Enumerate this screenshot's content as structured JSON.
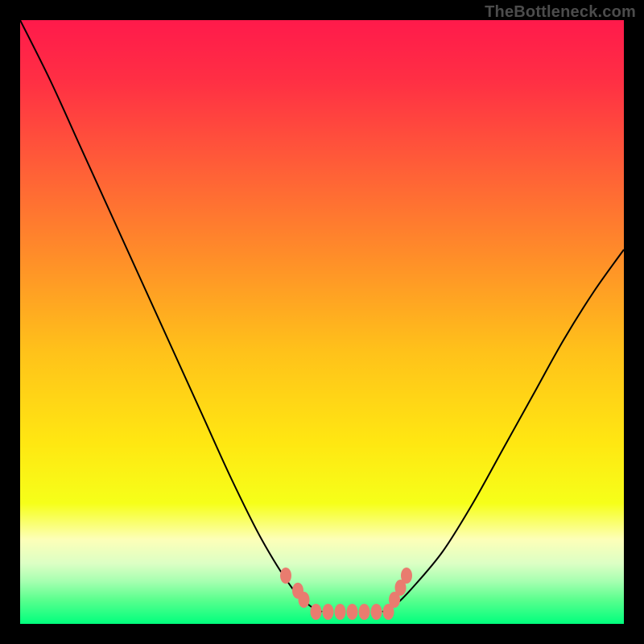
{
  "watermark": "TheBottleneck.com",
  "chart_data": {
    "type": "line",
    "title": "",
    "xlabel": "",
    "ylabel": "",
    "xlim": [
      0,
      100
    ],
    "ylim": [
      0,
      100
    ],
    "background_gradient_stops": [
      {
        "offset": 0.0,
        "color": "#ff1a4b"
      },
      {
        "offset": 0.1,
        "color": "#ff2f44"
      },
      {
        "offset": 0.25,
        "color": "#ff6037"
      },
      {
        "offset": 0.4,
        "color": "#ff9028"
      },
      {
        "offset": 0.55,
        "color": "#ffc21a"
      },
      {
        "offset": 0.7,
        "color": "#ffe712"
      },
      {
        "offset": 0.8,
        "color": "#f6ff19"
      },
      {
        "offset": 0.86,
        "color": "#fdffb8"
      },
      {
        "offset": 0.9,
        "color": "#dcffc4"
      },
      {
        "offset": 0.93,
        "color": "#a5ffb0"
      },
      {
        "offset": 0.96,
        "color": "#5aff8e"
      },
      {
        "offset": 1.0,
        "color": "#00ff7d"
      }
    ],
    "series": [
      {
        "name": "curve-left",
        "color": "#000000",
        "width": 2,
        "x": [
          0,
          5,
          10,
          15,
          20,
          25,
          30,
          35,
          40,
          45,
          48,
          50
        ],
        "y": [
          100,
          90,
          79,
          68,
          57,
          46,
          35,
          24,
          14,
          6,
          3,
          2
        ]
      },
      {
        "name": "curve-right",
        "color": "#000000",
        "width": 2,
        "x": [
          60,
          62,
          65,
          70,
          75,
          80,
          85,
          90,
          95,
          100
        ],
        "y": [
          2,
          3,
          6,
          12,
          20,
          29,
          38,
          47,
          55,
          62
        ]
      },
      {
        "name": "markers-left",
        "color": "#e97c6f",
        "type": "scatter",
        "x": [
          44,
          46,
          47
        ],
        "y": [
          8,
          5.5,
          4
        ]
      },
      {
        "name": "markers-right",
        "color": "#e97c6f",
        "type": "scatter",
        "x": [
          62,
          63,
          64
        ],
        "y": [
          4,
          6,
          8
        ]
      },
      {
        "name": "bottom-band",
        "color": "#e97c6f",
        "type": "scatter",
        "x": [
          49,
          51,
          53,
          55,
          57,
          59,
          61
        ],
        "y": [
          2,
          2,
          2,
          2,
          2,
          2,
          2
        ]
      }
    ]
  }
}
